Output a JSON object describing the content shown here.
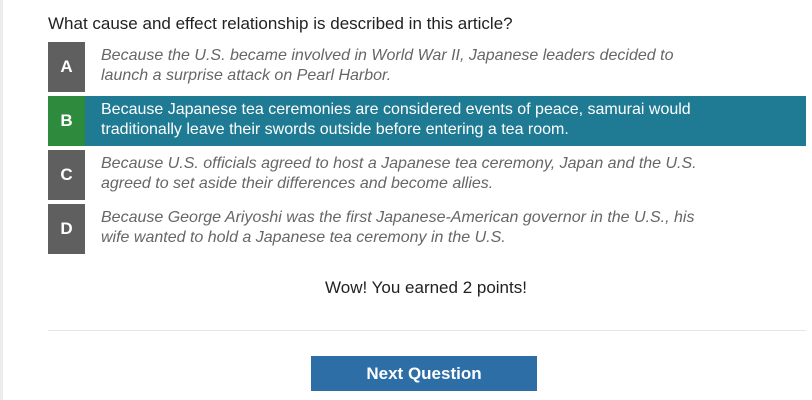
{
  "question": "What cause and effect relationship is described in this article?",
  "options": [
    {
      "letter": "A",
      "line1": "Because the U.S. became involved in World War II, Japanese leaders decided to",
      "line2": "launch a surprise attack on Pearl Harbor.",
      "selected": false
    },
    {
      "letter": "B",
      "line1": "Because Japanese tea ceremonies are considered events of peace, samurai would",
      "line2": "traditionally leave their swords outside before entering a tea room.",
      "selected": true
    },
    {
      "letter": "C",
      "line1": "Because U.S. officials agreed to host a Japanese tea ceremony, Japan and the U.S.",
      "line2": "agreed to set aside their differences and become allies.",
      "selected": false
    },
    {
      "letter": "D",
      "line1": "Because George Ariyoshi was the first Japanese-American governor in the U.S., his",
      "line2": "wife wanted to hold a Japanese tea ceremony in the U.S.",
      "selected": false
    }
  ],
  "feedback": "Wow! You earned 2 points!",
  "next_button_label": "Next Question",
  "colors": {
    "selected_row": "#1f7b94",
    "correct_badge": "#2e8b3e",
    "badge": "#5f5f5f",
    "button": "#2d6ea6"
  }
}
